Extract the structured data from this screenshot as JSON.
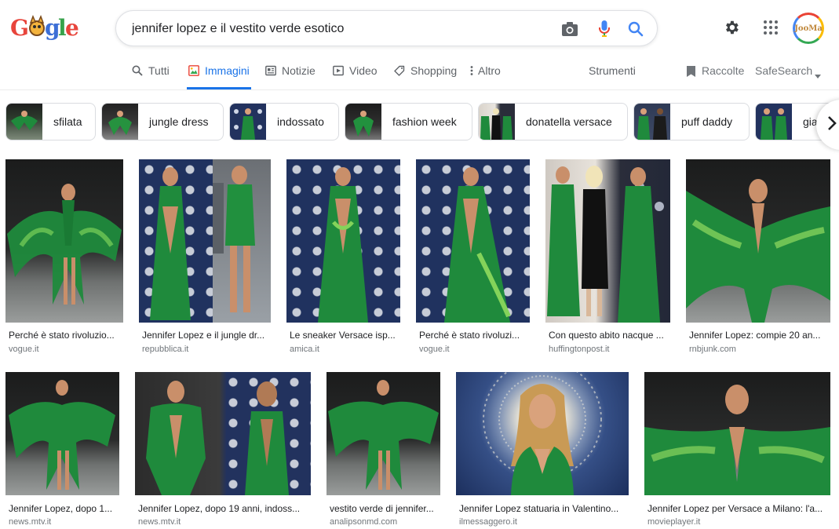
{
  "search": {
    "query": "jennifer lopez e il vestito verde esotico"
  },
  "user": {
    "avatar_text": "JooMa"
  },
  "tabs": [
    {
      "label": "Tutti",
      "icon": "search-icon"
    },
    {
      "label": "Immagini",
      "icon": "image-icon",
      "active": true
    },
    {
      "label": "Notizie",
      "icon": "news-icon"
    },
    {
      "label": "Video",
      "icon": "video-icon"
    },
    {
      "label": "Shopping",
      "icon": "tag-icon"
    },
    {
      "label": "Altro",
      "icon": "more-vert-icon"
    }
  ],
  "tools": {
    "strumenti": "Strumenti",
    "raccolte": "Raccolte",
    "safesearch": "SafeSearch"
  },
  "chips": [
    {
      "label": "sfilata"
    },
    {
      "label": "jungle dress"
    },
    {
      "label": "indossato"
    },
    {
      "label": "fashion week"
    },
    {
      "label": "donatella versace"
    },
    {
      "label": "puff daddy"
    },
    {
      "label": "gia"
    }
  ],
  "results": [
    {
      "title": "Perché è stato rivoluzio...",
      "domain": "vogue.it"
    },
    {
      "title": "Jennifer Lopez e il jungle dr...",
      "domain": "repubblica.it"
    },
    {
      "title": "Le sneaker Versace isp...",
      "domain": "amica.it"
    },
    {
      "title": "Perché è stato rivoluzi...",
      "domain": "vogue.it"
    },
    {
      "title": "Con questo abito nacque ...",
      "domain": "huffingtonpost.it"
    },
    {
      "title": "Jennifer Lopez: compie 20 an...",
      "domain": "rnbjunk.com"
    },
    {
      "title": "Jennifer Lopez, dopo 1...",
      "domain": "news.mtv.it"
    },
    {
      "title": "Jennifer Lopez, dopo 19 anni, indoss...",
      "domain": "news.mtv.it"
    },
    {
      "title": "vestito verde di jennifer...",
      "domain": "analipsonmd.com"
    },
    {
      "title": "Jennifer Lopez statuaria in Valentino...",
      "domain": "ilmessaggero.it"
    },
    {
      "title": "Jennifer Lopez per Versace a Milano: l'a...",
      "domain": "movieplayer.it"
    }
  ],
  "colors": {
    "accent": "#1a73e8",
    "dress_green": "#1f8a3c",
    "text_secondary": "#70757a"
  }
}
